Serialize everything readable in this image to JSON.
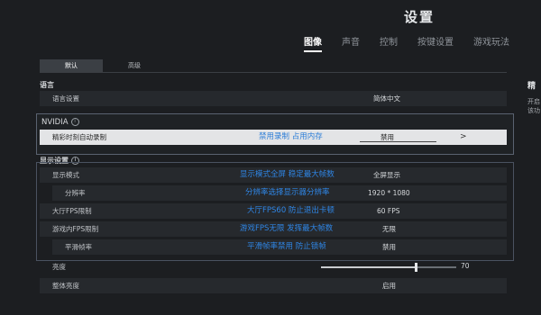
{
  "header": {
    "title": "设置",
    "tabs": [
      {
        "label": "图像",
        "active": true
      },
      {
        "label": "声音",
        "active": false
      },
      {
        "label": "控制",
        "active": false
      },
      {
        "label": "按键设置",
        "active": false
      },
      {
        "label": "游戏玩法",
        "active": false
      }
    ]
  },
  "subtabs": [
    {
      "label": "默认",
      "active": true
    },
    {
      "label": "高级",
      "active": false
    }
  ],
  "language": {
    "section_label": "语言",
    "row_label": "语言设置",
    "value": "简体中文"
  },
  "nvidia": {
    "title": "NVIDIA",
    "row_label": "精彩时刻自动录制",
    "annotation": "禁用录制 占用内存",
    "value": "禁用",
    "chevron": ">"
  },
  "display": {
    "section_label": "显示设置",
    "rows": [
      {
        "label": "显示模式",
        "annotation": "显示模式全屏 稳定最大帧数",
        "value": "全屏显示"
      },
      {
        "label": "分辨率",
        "annotation": "分辨率选择显示器分辨率",
        "value": "1920 * 1080"
      },
      {
        "label": "大厅FPS限制",
        "annotation": "大厅FPS60 防止退出卡顿",
        "value": "60 FPS"
      },
      {
        "label": "游戏内FPS限制",
        "annotation": "游戏FPS无限 发挥最大帧数",
        "value": "无限"
      },
      {
        "label": "平滑帧率",
        "annotation": "平滑帧率禁用 防止锁帧",
        "value": "禁用"
      }
    ],
    "brightness": {
      "label": "亮度",
      "value": "70",
      "level_percent": 70
    },
    "overall_brightness": {
      "label": "整体亮度",
      "value": "启用"
    }
  },
  "right_panel": {
    "title": "精",
    "lines": [
      "开启",
      "该功"
    ]
  },
  "colors": {
    "background": "#1c1e21",
    "annotation_blue": "#2f86e6",
    "highlight_row": "#e3e4e6"
  }
}
